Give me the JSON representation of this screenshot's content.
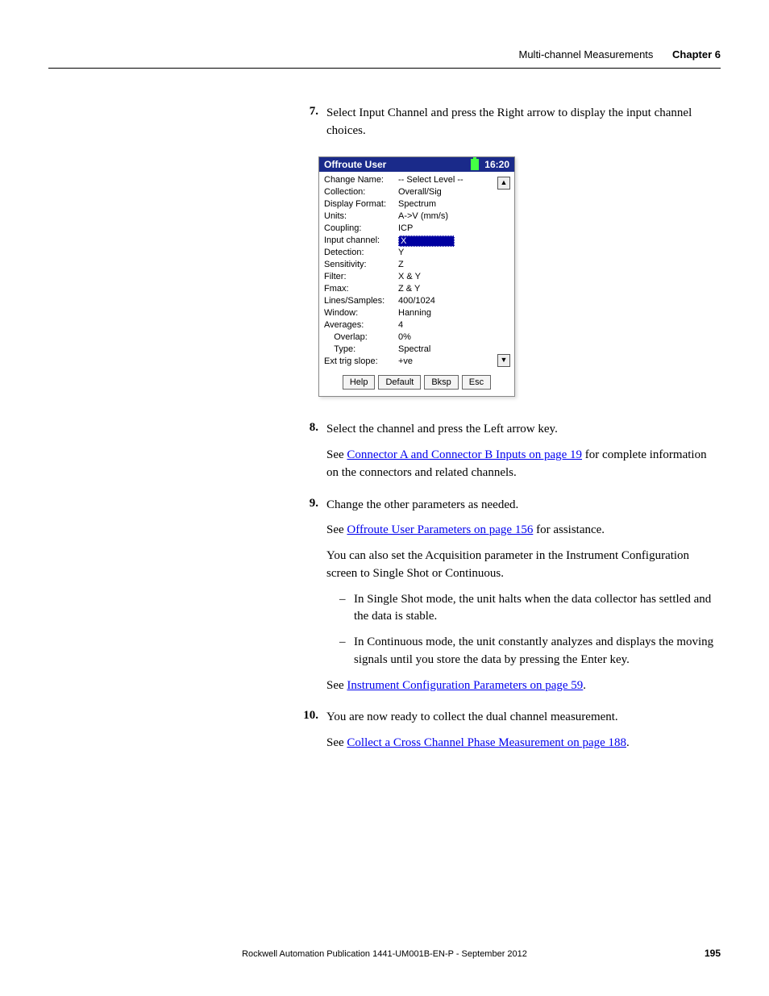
{
  "header": {
    "section": "Multi-channel Measurements",
    "chapter_label": "Chapter 6"
  },
  "steps": {
    "s7": {
      "num": "7.",
      "text": "Select Input Channel and press the Right arrow to display the input channel choices."
    },
    "s8": {
      "num": "8.",
      "text": "Select the channel and press the Left arrow key.",
      "p2a": "See ",
      "link": "Connector A and Connector B Inputs on page 19",
      "p2b": " for complete information on the connectors and related channels."
    },
    "s9": {
      "num": "9.",
      "text": "Change the other parameters as needed.",
      "p2a": "See ",
      "link": "Offroute User Parameters on page 156",
      "p2b": " for assistance.",
      "p3": "You can also set the Acquisition parameter in the Instrument Configuration screen to Single Shot or Continuous.",
      "b1": "In Single Shot mode, the unit halts when the data collector has settled and the data is stable.",
      "b2": "In Continuous mode, the unit constantly analyzes and displays the moving signals until you store the data by pressing the Enter key.",
      "p4a": "See ",
      "link2": "Instrument Configuration Parameters on page 59",
      "p4b": "."
    },
    "s10": {
      "num": "10.",
      "text": "You are now ready to collect the dual channel measurement.",
      "p2a": "See ",
      "link": "Collect a Cross Channel Phase Measurement on page 188",
      "p2b": "."
    }
  },
  "device": {
    "title": "Offroute User",
    "time": "16:20",
    "rows": {
      "change_name": {
        "label": "Change Name:",
        "value": "-- Select Level --"
      },
      "collection": {
        "label": "Collection:",
        "value": "Overall/Sig"
      },
      "display_format": {
        "label": "Display Format:",
        "value": "Spectrum"
      },
      "units": {
        "label": "Units:",
        "value": "A->V (mm/s)"
      },
      "coupling": {
        "label": "Coupling:",
        "value": "ICP"
      },
      "input_channel": {
        "label": "Input channel:",
        "value": "X"
      },
      "detection": {
        "label": "Detection:",
        "value": "Y"
      },
      "sensitivity": {
        "label": "Sensitivity:",
        "value": "Z"
      },
      "filter": {
        "label": "Filter:",
        "value": "X & Y"
      },
      "fmax": {
        "label": "Fmax:",
        "value": "Z & Y"
      },
      "lines_samples": {
        "label": "Lines/Samples:",
        "value": "400/1024"
      },
      "window": {
        "label": "Window:",
        "value": "Hanning"
      },
      "averages": {
        "label": "Averages:",
        "value": "4"
      },
      "overlap": {
        "label": "    Overlap:",
        "value": "0%"
      },
      "type": {
        "label": "    Type:",
        "value": "Spectral"
      },
      "ext_trig": {
        "label": "Ext trig slope:",
        "value": "+ve"
      }
    },
    "buttons": {
      "help": "Help",
      "default": "Default",
      "bksp": "Bksp",
      "esc": "Esc"
    }
  },
  "footer": {
    "pub": "Rockwell Automation Publication 1441-UM001B-EN-P - September 2012",
    "page": "195"
  }
}
